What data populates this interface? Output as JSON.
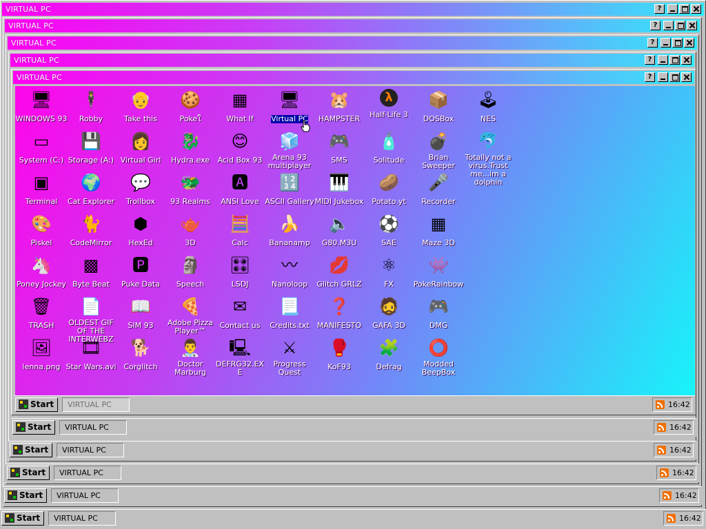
{
  "windows": [
    {
      "title": "VIRTUAL PC",
      "taskbar_label": "VIRTUAL PC",
      "clock": "16:42",
      "start_label": "Start"
    },
    {
      "title": "VIRTUAL PC",
      "taskbar_label": "VIRTUAL PC",
      "clock": "16:42",
      "start_label": "Start"
    },
    {
      "title": "VIRTUAL PC",
      "taskbar_label": "VIRTUAL PC",
      "clock": "16:42",
      "start_label": "Start"
    },
    {
      "title": "VIRTUAL PC",
      "taskbar_label": "VIRTUAL PC",
      "clock": "16:42",
      "start_label": "Start"
    },
    {
      "title": "VIRTUAL PC",
      "taskbar_label": "VIRTUAL PC",
      "clock": "16:42",
      "start_label": "Start"
    }
  ],
  "window_buttons": {
    "help": "?"
  },
  "desktop": {
    "selected_icon": "Virtual PC",
    "icons": [
      {
        "label": "WINDOWS 93",
        "icon": "computer-icon"
      },
      {
        "label": "System (C:)",
        "icon": "drive-icon"
      },
      {
        "label": "Terminal",
        "icon": "terminal-icon"
      },
      {
        "label": "Piskel",
        "icon": "palette-icon"
      },
      {
        "label": "Poney Jockey",
        "icon": "pony-icon"
      },
      {
        "label": "TRASH",
        "icon": "trash-icon"
      },
      {
        "label": "lenna.png",
        "icon": "image-file-icon"
      },
      {
        "label": "Robby",
        "icon": "stickman-icon"
      },
      {
        "label": "Storage (A:)",
        "icon": "floppy-drive-icon"
      },
      {
        "label": "Cat Explorer",
        "icon": "globe-cat-icon"
      },
      {
        "label": "CodeMirror",
        "icon": "code-icon"
      },
      {
        "label": "Byte Beat",
        "icon": "bytebeat-icon"
      },
      {
        "label": "OLDEST GIF OF THE INTERWEBZ",
        "icon": "gif-file-icon"
      },
      {
        "label": "Star Wars.avi",
        "icon": "video-file-icon"
      },
      {
        "label": "Take this",
        "icon": "old-man-icon"
      },
      {
        "label": "Virtual Girl",
        "icon": "face-icon"
      },
      {
        "label": "Trollbox",
        "icon": "chat-icon"
      },
      {
        "label": "HexEd",
        "icon": "hex-icon"
      },
      {
        "label": "Puke Data",
        "icon": "pd-icon"
      },
      {
        "label": "SIM 93",
        "icon": "book-icon"
      },
      {
        "label": "Corglitch",
        "icon": "corgi-icon"
      },
      {
        "label": "Pokeใ",
        "icon": "cookie-icon"
      },
      {
        "label": "Hydra.exe",
        "icon": "dragon-icon"
      },
      {
        "label": "93 Realms",
        "icon": "realms-icon"
      },
      {
        "label": "3D",
        "icon": "teapot-icon"
      },
      {
        "label": "Speech",
        "icon": "speech-face-icon"
      },
      {
        "label": "Adobe Pizza Player™",
        "icon": "pizza-icon"
      },
      {
        "label": "Doctor Marburg",
        "icon": "doctor-icon"
      },
      {
        "label": "What If",
        "icon": "calendar-icon"
      },
      {
        "label": "Acid Box 93",
        "icon": "smiley-icon"
      },
      {
        "label": "ANSI Love",
        "icon": "ansi-icon"
      },
      {
        "label": "Calc",
        "icon": "calculator-icon"
      },
      {
        "label": "LSDJ",
        "icon": "lsdj-icon"
      },
      {
        "label": "Contact us",
        "icon": "contact-icon"
      },
      {
        "label": "DEFRG32.EXE",
        "icon": "defrag-face-icon"
      },
      {
        "label": "Virtual PC",
        "icon": "virtual-pc-icon"
      },
      {
        "label": "Arena 93 multiplayer",
        "icon": "cube-icon"
      },
      {
        "label": "ASCII Gallery",
        "icon": "ascii-icon"
      },
      {
        "label": "Bananamp",
        "icon": "banana-icon"
      },
      {
        "label": "Nanoloop",
        "icon": "wave-icon"
      },
      {
        "label": "Credits.txt",
        "icon": "text-file-icon"
      },
      {
        "label": "Progress Quest",
        "icon": "swords-icon"
      },
      {
        "label": "HAMPSTER",
        "icon": "hamster-icon"
      },
      {
        "label": "SMS",
        "icon": "sms-console-icon"
      },
      {
        "label": "MIDI Jukebox",
        "icon": "piano-icon"
      },
      {
        "label": "G80.M3U",
        "icon": "audio-file-icon"
      },
      {
        "label": "Glitch GRLZ",
        "icon": "lips-icon"
      },
      {
        "label": "MANIFESTO",
        "icon": "question-icon"
      },
      {
        "label": "KoF93",
        "icon": "fighter-icon"
      },
      {
        "label": "Half-Life 3",
        "icon": "halflife-icon"
      },
      {
        "label": "Solitude",
        "icon": "bottle-icon"
      },
      {
        "label": "Potato.yt",
        "icon": "potato-icon"
      },
      {
        "label": "SAE",
        "icon": "ball-icon"
      },
      {
        "label": "FX",
        "icon": "atom-icon"
      },
      {
        "label": "GAFA 3D",
        "icon": "duke-icon"
      },
      {
        "label": "Defrag",
        "icon": "defrag-icon"
      },
      {
        "label": "DOSBox",
        "icon": "dosbox-icon"
      },
      {
        "label": "Brian Sweeper",
        "icon": "mine-icon"
      },
      {
        "label": "Recorder",
        "icon": "microphone-icon"
      },
      {
        "label": "Maze 3D",
        "icon": "maze-icon"
      },
      {
        "label": "PokeRainbow",
        "icon": "pokerainbow-icon"
      },
      {
        "label": "DMG",
        "icon": "gameboy-icon"
      },
      {
        "label": "Modded BeepBox",
        "icon": "ring-icon"
      },
      {
        "label": "NES",
        "icon": "nes-icon"
      },
      {
        "label": "Totally not a virus.Trust me...im a dolphin",
        "icon": "dolphin-icon"
      }
    ]
  }
}
